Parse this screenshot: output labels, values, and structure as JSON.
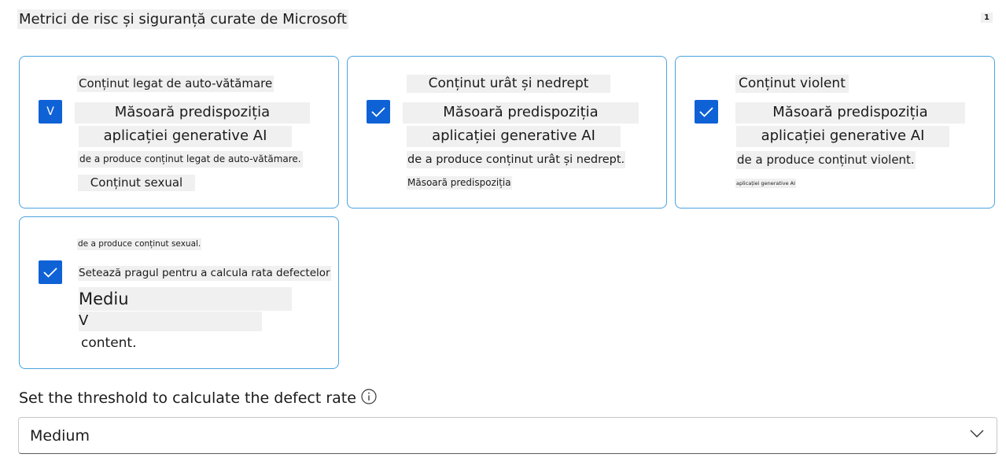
{
  "header": {
    "title": "Metrici de risc și siguranță curate de Microsoft",
    "badge": "1"
  },
  "cards": [
    {
      "name": "Conținut legat de auto-vătămare",
      "checkbox_glyph": "V",
      "lines": [
        "Măsoară predispoziția",
        "aplicației generative AI",
        "de a produce conținut legat de auto-vătămare.",
        "Conținut sexual"
      ]
    },
    {
      "name": "Conținut urât și nedrept",
      "lines": [
        "Măsoară predispoziția",
        "aplicației generative AI",
        "de a produce conținut urât și nedrept.",
        "Măsoară predispoziția"
      ]
    },
    {
      "name": "Conținut violent",
      "lines": [
        "Măsoară predispoziția",
        "aplicației generative AI",
        "de a produce conținut violent.",
        "aplicației generative AI"
      ]
    },
    {
      "lines": [
        "de a produce conținut sexual.",
        "Setează pragul pentru a calcula rata defectelor",
        "Mediu",
        "V",
        "content."
      ]
    }
  ],
  "threshold": {
    "label": "Set the threshold to calculate the defect rate",
    "value": "Medium"
  },
  "colors": {
    "accent": "#0f62d6",
    "card_border": "#4aa3df",
    "highlight": "#f0f0f0"
  }
}
